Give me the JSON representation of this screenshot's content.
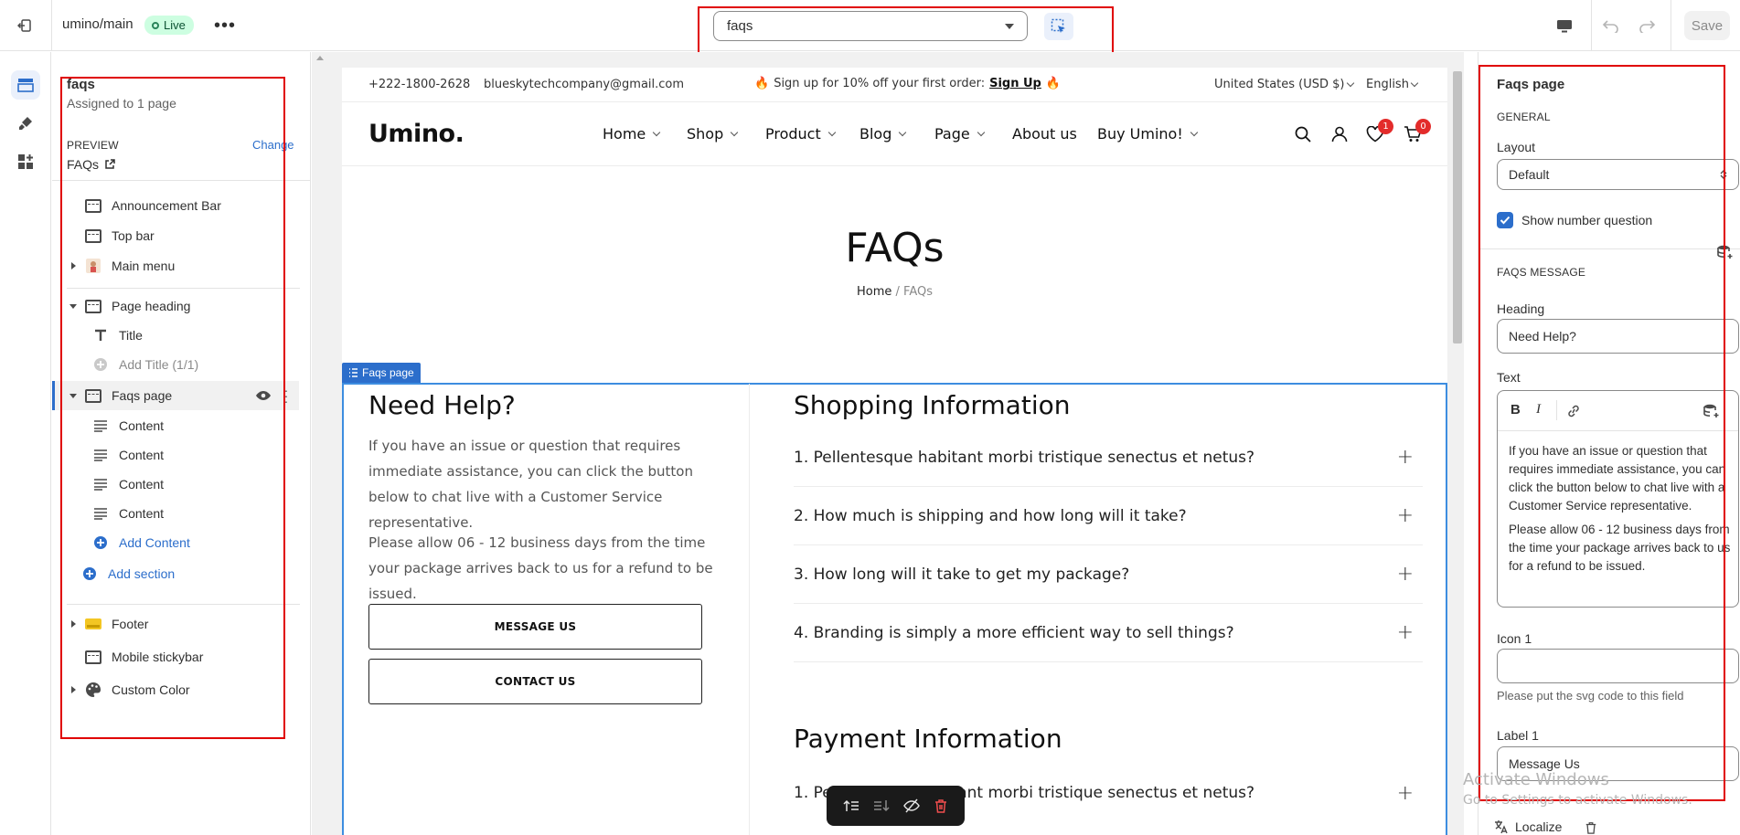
{
  "topbar": {
    "theme_name": "umino/main",
    "status_badge": "Live",
    "more_label": "•••",
    "page_select_value": "faqs",
    "save_label": "Save"
  },
  "sidebar": {
    "template_title": "faqs",
    "assigned": "Assigned to 1 page",
    "preview_label": "PREVIEW",
    "change_label": "Change",
    "preview_link": "FAQs",
    "items": [
      {
        "label": "Announcement Bar"
      },
      {
        "label": "Top bar"
      },
      {
        "label": "Main menu"
      },
      {
        "label": "Page heading"
      },
      {
        "label": "Title"
      },
      {
        "label": "Add Title (1/1)"
      },
      {
        "label": "Faqs page"
      },
      {
        "label": "Content"
      },
      {
        "label": "Content"
      },
      {
        "label": "Content"
      },
      {
        "label": "Content"
      },
      {
        "label": "Add Content"
      },
      {
        "label": "Add section"
      },
      {
        "label": "Footer"
      },
      {
        "label": "Mobile stickybar"
      },
      {
        "label": "Custom Color"
      }
    ]
  },
  "preview": {
    "phone": "+222-1800-2628",
    "email": "blueskytechcompany@gmail.com",
    "promo_text": "Sign up for 10% off your first order:",
    "promo_link": "Sign Up",
    "currency": "United States (USD $)",
    "language": "English",
    "logo": "Umino.",
    "nav": [
      "Home",
      "Shop",
      "Product",
      "Blog",
      "Page",
      "About us",
      "Buy Umino!"
    ],
    "wishlist_count": "1",
    "cart_count": "0",
    "page_title": "FAQs",
    "breadcrumb_home": "Home",
    "breadcrumb_sep": "/",
    "breadcrumb_current": "FAQs",
    "section_tag": "Faqs page",
    "help_heading": "Need Help?",
    "help_p1": "If you have an issue or question that requires immediate assistance, you can click the button below to chat live with a Customer Service representative.",
    "help_p2": "Please allow 06 - 12 business days from the time your package arrives back to us for a refund to be issued.",
    "btn_message": "MESSAGE US",
    "btn_contact": "CONTACT US",
    "shopping_heading": "Shopping Information",
    "questions": [
      "1. Pellentesque habitant morbi tristique senectus et netus?",
      "2. How much is shipping and how long will it take?",
      "3. How long will it take to get my package?",
      "4. Branding is simply a more efficient way to sell things?"
    ],
    "payment_heading": "Payment Information",
    "payment_questions": [
      "1. Pellentesque habitant morbi tristique senectus et netus?"
    ]
  },
  "settings": {
    "title": "Faqs page",
    "general_cap": "GENERAL",
    "layout_label": "Layout",
    "layout_value": "Default",
    "show_number_label": "Show number question",
    "message_cap": "FAQS MESSAGE",
    "heading_label": "Heading",
    "heading_value": "Need Help?",
    "text_label": "Text",
    "text_p1": "If you have an issue or question that requires immediate assistance, you can click the button below to chat live with a Customer Service representative.",
    "text_p2": "Please allow 06 - 12 business days from the time your package arrives back to us for a refund to be issued.",
    "icon1_label": "Icon 1",
    "icon1_value": "",
    "icon1_help": "Please put the svg code to this field",
    "label1_label": "Label 1",
    "label1_value": "Message Us",
    "localize_label": "Localize"
  },
  "watermark": {
    "line1": "Activate Windows",
    "line2": "Go to Settings to activate Windows."
  },
  "colors": {
    "accent": "#2c6ecb",
    "selection_frame": "#3d8de0",
    "badge_red": "#e32c2b",
    "live_green": "#cdfee1"
  }
}
